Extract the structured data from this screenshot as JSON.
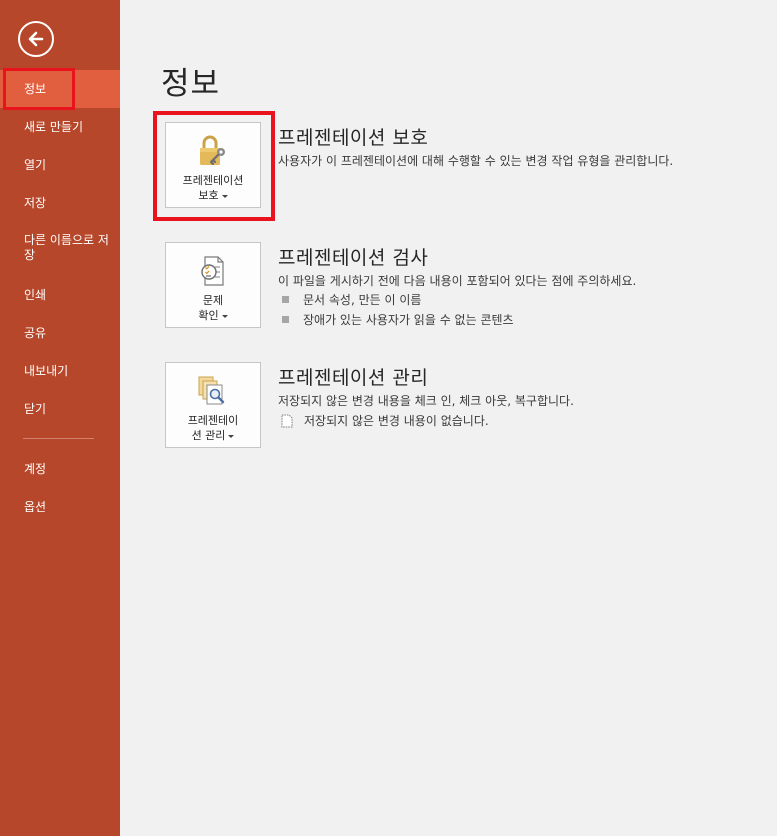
{
  "sidebar": {
    "back_label": "",
    "items": [
      {
        "label": "정보"
      },
      {
        "label": "새로 만들기"
      },
      {
        "label": "열기"
      },
      {
        "label": "저장"
      },
      {
        "label": "다른 이름으로 저장"
      },
      {
        "label": "인쇄"
      },
      {
        "label": "공유"
      },
      {
        "label": "내보내기"
      },
      {
        "label": "닫기"
      },
      {
        "label": "계정"
      },
      {
        "label": "옵션"
      }
    ]
  },
  "main": {
    "title": "정보",
    "sections": [
      {
        "tile_line1": "프레젠테이션",
        "tile_line2": "보호",
        "title": "프레젠테이션 보호",
        "desc": "사용자가 이 프레젠테이션에 대해 수행할 수 있는 변경 작업 유형을 관리합니다.",
        "icon": "lock-key-icon"
      },
      {
        "tile_line1": "문제",
        "tile_line2": "확인",
        "title": "프레젠테이션 검사",
        "desc": "이 파일을 게시하기 전에 다음 내용이 포함되어 있다는 점에 주의하세요.",
        "bullets": [
          "문서 속성, 만든 이 이름",
          "장애가 있는 사용자가 읽을 수 없는 콘텐츠"
        ],
        "icon": "inspect-checklist-icon"
      },
      {
        "tile_line1": "프레젠테이",
        "tile_line2": "션 관리",
        "title": "프레젠테이션 관리",
        "desc": "저장되지 않은 변경 내용을 체크 인, 체크 아웃, 복구합니다.",
        "note": "저장되지 않은 변경 내용이 없습니다.",
        "icon": "manage-versions-icon"
      }
    ]
  },
  "colors": {
    "sidebar": "#b7472a",
    "active": "#e15f3f",
    "highlight": "#e8131d",
    "background": "#f1f1f1"
  }
}
